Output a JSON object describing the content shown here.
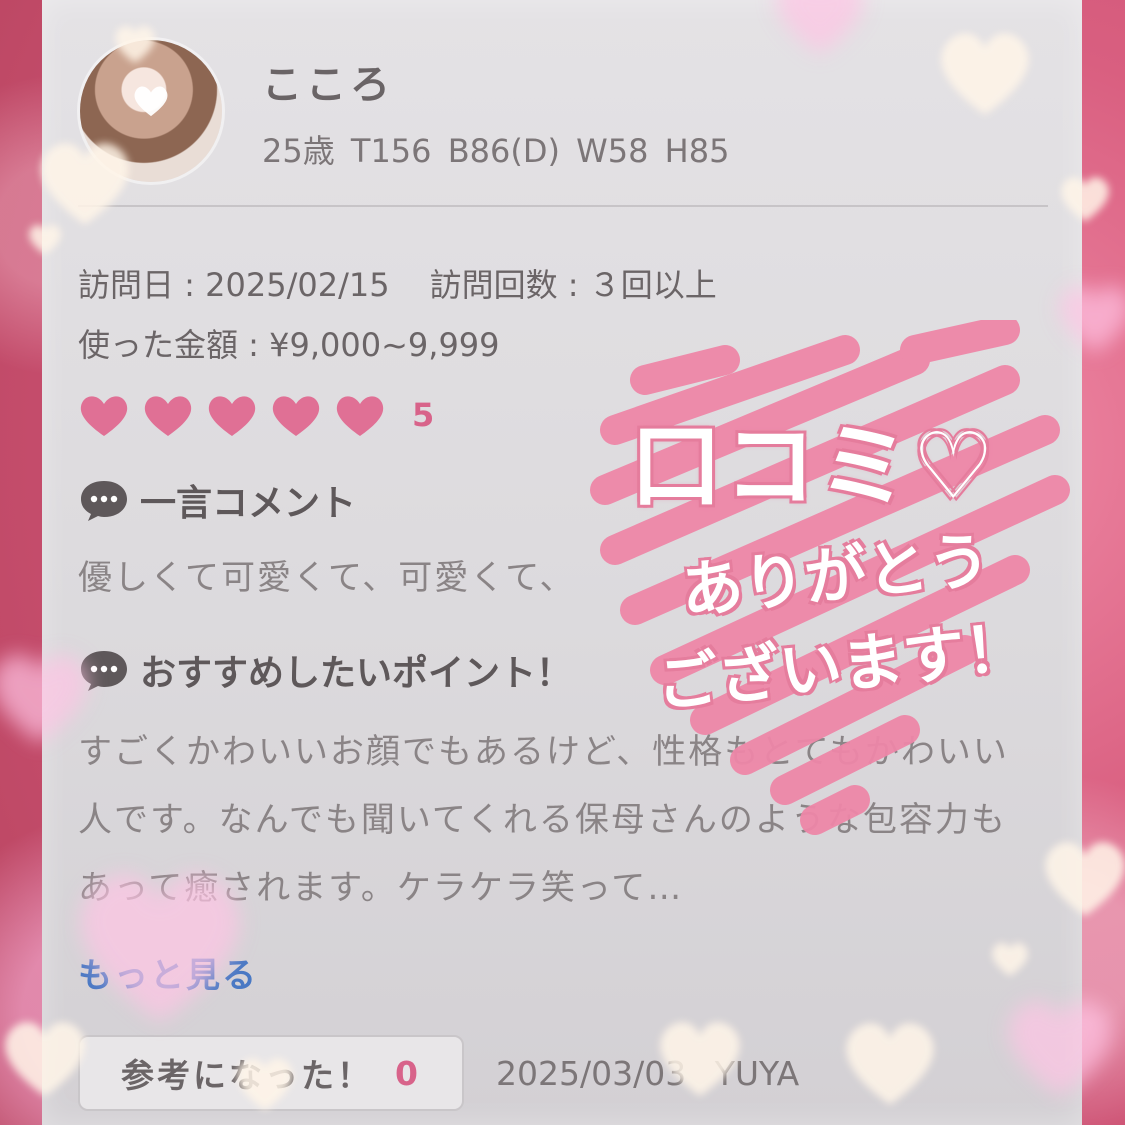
{
  "profile": {
    "name": "こころ",
    "stats": "25歳  T156  B86(D)  W58  H85"
  },
  "visit": {
    "date_label": "訪問日 : 2025/02/15",
    "count_label": "訪問回数 : ３回以上",
    "amount_label": "使った金額 : ¥9,000~9,999"
  },
  "rating": {
    "value": 5,
    "value_text": "5",
    "max": 5,
    "color": "#e07095"
  },
  "comment": {
    "title": "一言コメント",
    "text": "優しくて可愛くて、可愛くて、"
  },
  "point": {
    "title": "おすすめしたいポイント！",
    "text": "すごくかわいいお顔でもあるけど、性格もとてもかわいい人です。なんでも聞いてくれる保母さんのような包容力もあって癒されます。ケラケラ笑って…"
  },
  "actions": {
    "more_label": "もっと見る",
    "helpful_label": "参考になった！",
    "helpful_count": "0"
  },
  "meta": {
    "post_date": "2025/03/03",
    "author": "YUYA"
  },
  "sticker": {
    "title": "口コミ♡",
    "line2": "ありがとう",
    "line3": "ございます！"
  },
  "colors": {
    "accent": "#d8638a",
    "link": "#4a79c4",
    "background": "#d95f80"
  }
}
